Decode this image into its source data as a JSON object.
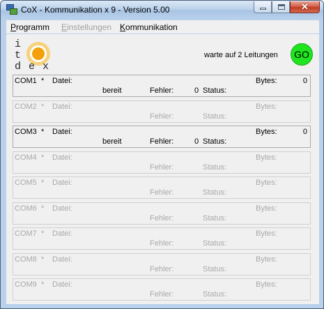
{
  "window": {
    "title": "CoX - Kommunikation x 9 - Version 5.00",
    "close_glyph": "✕"
  },
  "menu": {
    "items": [
      {
        "label": "Programm",
        "enabled": true
      },
      {
        "label": "Einstellungen",
        "enabled": false
      },
      {
        "label": "Kommunikation",
        "enabled": true
      }
    ]
  },
  "logo": {
    "letters": [
      "i",
      "t",
      "d",
      "e",
      "x"
    ]
  },
  "status": {
    "wait_text": "warte auf 2 Leitungen",
    "go_label": "GO",
    "go_color": "#1ee51e"
  },
  "ports": [
    {
      "name": "COM1",
      "star": "*",
      "datei_label": "Datei:",
      "bytes_label": "Bytes:",
      "bytes_value": "0",
      "state": "bereit",
      "fehler_label": "Fehler:",
      "fehler_value": "0",
      "status_label": "Status:",
      "active": true
    },
    {
      "name": "COM2",
      "star": "*",
      "datei_label": "Datei:",
      "bytes_label": "Bytes:",
      "bytes_value": "",
      "state": "",
      "fehler_label": "Fehler:",
      "fehler_value": "",
      "status_label": "Status:",
      "active": false
    },
    {
      "name": "COM3",
      "star": "*",
      "datei_label": "Datei:",
      "bytes_label": "Bytes:",
      "bytes_value": "0",
      "state": "bereit",
      "fehler_label": "Fehler:",
      "fehler_value": "0",
      "status_label": "Status:",
      "active": true
    },
    {
      "name": "COM4",
      "star": "*",
      "datei_label": "Datei:",
      "bytes_label": "Bytes:",
      "bytes_value": "",
      "state": "",
      "fehler_label": "Fehler:",
      "fehler_value": "",
      "status_label": "Status:",
      "active": false
    },
    {
      "name": "COM5",
      "star": "*",
      "datei_label": "Datei:",
      "bytes_label": "Bytes:",
      "bytes_value": "",
      "state": "",
      "fehler_label": "Fehler:",
      "fehler_value": "",
      "status_label": "Status:",
      "active": false
    },
    {
      "name": "COM6",
      "star": "*",
      "datei_label": "Datei:",
      "bytes_label": "Bytes:",
      "bytes_value": "",
      "state": "",
      "fehler_label": "Fehler:",
      "fehler_value": "",
      "status_label": "Status:",
      "active": false
    },
    {
      "name": "COM7",
      "star": "*",
      "datei_label": "Datei:",
      "bytes_label": "Bytes:",
      "bytes_value": "",
      "state": "",
      "fehler_label": "Fehler:",
      "fehler_value": "",
      "status_label": "Status:",
      "active": false
    },
    {
      "name": "COM8",
      "star": "*",
      "datei_label": "Datei:",
      "bytes_label": "Bytes:",
      "bytes_value": "",
      "state": "",
      "fehler_label": "Fehler:",
      "fehler_value": "",
      "status_label": "Status:",
      "active": false
    },
    {
      "name": "COM9",
      "star": "*",
      "datei_label": "Datei:",
      "bytes_label": "Bytes:",
      "bytes_value": "",
      "state": "",
      "fehler_label": "Fehler:",
      "fehler_value": "",
      "status_label": "Status:",
      "active": false
    }
  ]
}
